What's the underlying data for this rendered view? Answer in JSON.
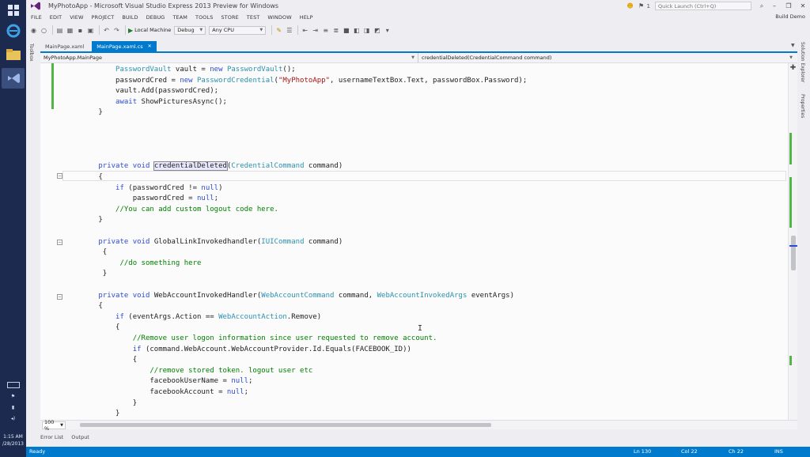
{
  "window": {
    "title": "MyPhotoApp - Microsoft Visual Studio Express 2013 Preview for Windows",
    "quick_launch_placeholder": "Quick Launch (Ctrl+Q)",
    "notification_count": "1",
    "account": "Build Demo"
  },
  "menu": [
    "FILE",
    "EDIT",
    "VIEW",
    "PROJECT",
    "BUILD",
    "DEBUG",
    "TEAM",
    "TOOLS",
    "STORE",
    "TEST",
    "WINDOW",
    "HELP"
  ],
  "toolbar": {
    "run_target": "Local Machine",
    "configuration": "Debug",
    "platform": "Any CPU"
  },
  "side_panels": {
    "left": "Toolbox",
    "right": [
      "Solution Explorer",
      "Properties"
    ]
  },
  "tabs": [
    {
      "label": "MainPage.xaml",
      "active": false
    },
    {
      "label": "MainPage.xaml.cs",
      "active": true
    }
  ],
  "nav": {
    "class": "MyPhotoApp.MainPage",
    "member": "credentialDeleted(CredentialCommand command)"
  },
  "code": [
    [
      [
        "            ",
        ""
      ],
      [
        "PasswordVault",
        "ty"
      ],
      [
        " vault = ",
        ""
      ],
      [
        "new",
        "kw"
      ],
      [
        " ",
        ""
      ],
      [
        "PasswordVault",
        "ty"
      ],
      [
        "();",
        ""
      ]
    ],
    [
      [
        "            passwordCred = ",
        ""
      ],
      [
        "new",
        "kw"
      ],
      [
        " ",
        ""
      ],
      [
        "PasswordCredential",
        "ty"
      ],
      [
        "(",
        ""
      ],
      [
        "\"MyPhotoApp\"",
        "str"
      ],
      [
        ", usernameTextBox.Text, passwordBox.Password);",
        ""
      ]
    ],
    [
      [
        "            vault.Add(passwordCred);",
        ""
      ]
    ],
    [
      [
        "            ",
        ""
      ],
      [
        "await",
        "kw"
      ],
      [
        " ShowPicturesAsync();",
        ""
      ]
    ],
    [
      [
        "        }",
        ""
      ]
    ],
    [],
    [],
    [],
    [],
    [
      [
        "        ",
        ""
      ],
      [
        "private",
        "kw"
      ],
      [
        " ",
        ""
      ],
      [
        "void",
        "kw"
      ],
      [
        " ",
        ""
      ],
      [
        "credentialDeleted",
        "cursor-word"
      ],
      [
        "(",
        ""
      ],
      [
        "CredentialCommand",
        "ty"
      ],
      [
        " command)",
        ""
      ]
    ],
    [
      [
        "        {",
        ""
      ]
    ],
    [
      [
        "            ",
        ""
      ],
      [
        "if",
        "kw"
      ],
      [
        " (passwordCred != ",
        ""
      ],
      [
        "null",
        "kw"
      ],
      [
        ")",
        ""
      ]
    ],
    [
      [
        "                passwordCred = ",
        ""
      ],
      [
        "null",
        "kw"
      ],
      [
        ";",
        ""
      ]
    ],
    [
      [
        "            ",
        ""
      ],
      [
        "//You can add custom logout code here.",
        "cm"
      ]
    ],
    [
      [
        "        }",
        ""
      ]
    ],
    [],
    [
      [
        "        ",
        ""
      ],
      [
        "private",
        "kw"
      ],
      [
        " ",
        ""
      ],
      [
        "void",
        "kw"
      ],
      [
        " GlobalLinkInvokedhandler(",
        ""
      ],
      [
        "IUICommand",
        "ty"
      ],
      [
        " command)",
        ""
      ]
    ],
    [
      [
        "         {",
        ""
      ]
    ],
    [
      [
        "             ",
        ""
      ],
      [
        "//do something here",
        "cm"
      ]
    ],
    [
      [
        "         }",
        ""
      ]
    ],
    [],
    [
      [
        "        ",
        ""
      ],
      [
        "private",
        "kw"
      ],
      [
        " ",
        ""
      ],
      [
        "void",
        "kw"
      ],
      [
        " WebAccountInvokedHandler(",
        ""
      ],
      [
        "WebAccountCommand",
        "ty"
      ],
      [
        " command, ",
        ""
      ],
      [
        "WebAccountInvokedArgs",
        "ty"
      ],
      [
        " eventArgs)",
        ""
      ]
    ],
    [
      [
        "        {",
        ""
      ]
    ],
    [
      [
        "            ",
        ""
      ],
      [
        "if",
        "kw"
      ],
      [
        " (eventArgs.Action == ",
        ""
      ],
      [
        "WebAccountAction",
        "ty"
      ],
      [
        ".Remove)",
        ""
      ]
    ],
    [
      [
        "            {",
        ""
      ]
    ],
    [
      [
        "                ",
        ""
      ],
      [
        "//Remove user logon information since user requested to remove account.",
        "cm"
      ]
    ],
    [
      [
        "                ",
        ""
      ],
      [
        "if",
        "kw"
      ],
      [
        " (command.WebAccount.WebAccountProvider.Id.Equals(FACEBOOK_ID))",
        ""
      ]
    ],
    [
      [
        "                {",
        ""
      ]
    ],
    [
      [
        "                    ",
        ""
      ],
      [
        "//remove stored token. logout user etc",
        "cm"
      ]
    ],
    [
      [
        "                    facebookUserName = ",
        ""
      ],
      [
        "null",
        "kw"
      ],
      [
        ";",
        ""
      ]
    ],
    [
      [
        "                    facebookAccount = ",
        ""
      ],
      [
        "null",
        "kw"
      ],
      [
        ";",
        ""
      ]
    ],
    [
      [
        "                }",
        ""
      ]
    ],
    [
      [
        "            }",
        ""
      ]
    ]
  ],
  "zoom": "100 %",
  "bottom_tabs": [
    "Error List",
    "Output"
  ],
  "status": {
    "text": "Ready",
    "line": "Ln 130",
    "col": "Col 22",
    "ch": "Ch 22",
    "mode": "INS"
  },
  "clock": {
    "time": "1:15 AM",
    "date": "/28/2013"
  },
  "colors": {
    "accent": "#007acc",
    "keyword": "#2a4bd7",
    "type": "#2b91af",
    "string": "#a31515",
    "comment": "#008000"
  }
}
